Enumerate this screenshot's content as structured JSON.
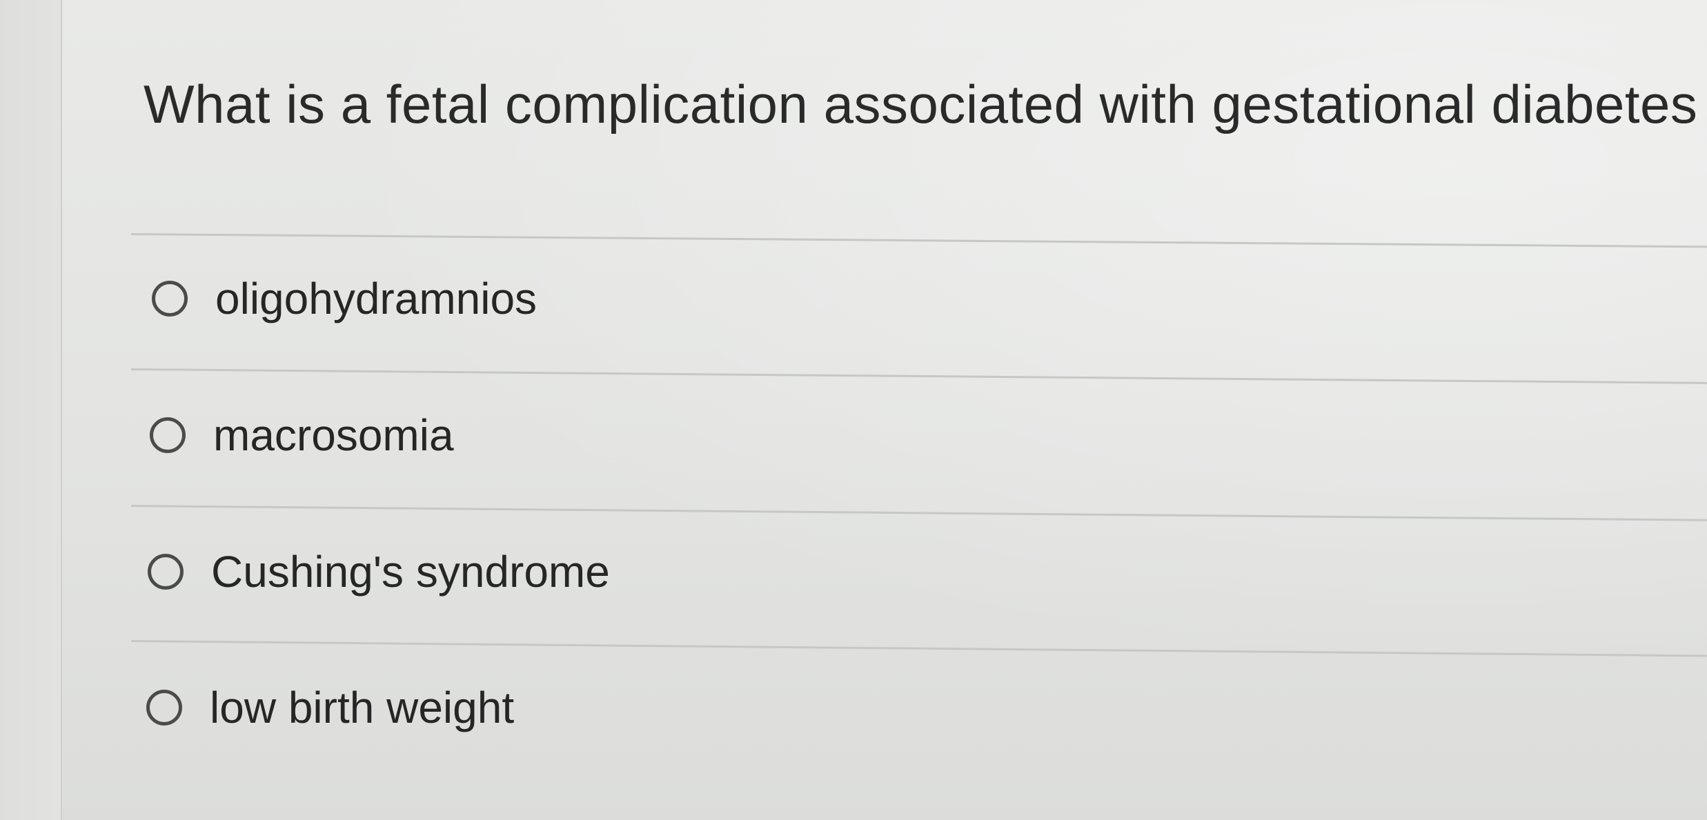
{
  "question": {
    "text": "What is a fetal complication associated with gestational diabetes"
  },
  "options": [
    {
      "label": "oligohydramnios",
      "selected": false
    },
    {
      "label": "macrosomia",
      "selected": false
    },
    {
      "label": "Cushing's syndrome",
      "selected": false
    },
    {
      "label": "low birth weight",
      "selected": false
    }
  ],
  "colors": {
    "background": "#e6e7e5",
    "text": "#2a2a2a",
    "divider": "#c6c8c5",
    "radio_border": "#4b4b4b"
  },
  "icons": {
    "radio_unselected": "radio-unselected-icon"
  }
}
